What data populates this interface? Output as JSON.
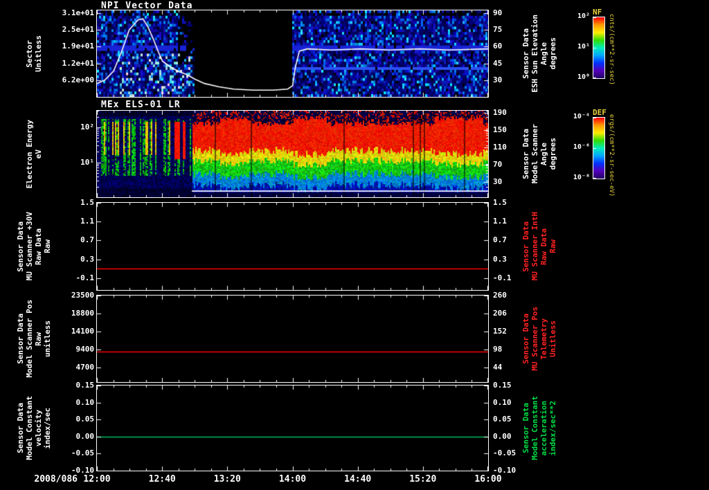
{
  "page": {
    "date_label": "2008/086"
  },
  "x_axis": {
    "t_start": 12,
    "t_end": 16,
    "ticks": [
      {
        "t": 12.0,
        "label": "12:00"
      },
      {
        "t": 12.667,
        "label": "12:40"
      },
      {
        "t": 13.333,
        "label": "13:20"
      },
      {
        "t": 14.0,
        "label": "14:00"
      },
      {
        "t": 14.667,
        "label": "14:40"
      },
      {
        "t": 15.333,
        "label": "15:20"
      },
      {
        "t": 16.0,
        "label": "16:00"
      }
    ]
  },
  "colors": {
    "background": "#000000",
    "frame": "#ffffff",
    "text": "#ffffff",
    "red_line": "#ff0000",
    "red_label": "#ff2222",
    "green_line": "#00c060",
    "green_label": "#00dd44",
    "colorbar_label": "#e8d23c",
    "palette": [
      "#ff0000",
      "#ff9900",
      "#ffee00",
      "#33dd00",
      "#00eebb",
      "#00aaff",
      "#0033ff",
      "#5500bb",
      "#220066"
    ]
  },
  "chart_data": [
    {
      "type": "heatmap",
      "id": "npi-vector",
      "title": "NPI Vector Data",
      "left_axis": {
        "label_lines": [
          "Sector",
          "Unitless"
        ],
        "min": 0,
        "max": 32,
        "ticks": [
          {
            "v": 31,
            "label": "3.1e+01"
          },
          {
            "v": 24.8,
            "label": "2.5e+01"
          },
          {
            "v": 18.6,
            "label": "1.9e+01"
          },
          {
            "v": 12.4,
            "label": "1.2e+01"
          },
          {
            "v": 6.2,
            "label": "6.2e+00"
          }
        ]
      },
      "right_axis": {
        "label_lines": [
          "Sensor Data",
          "ESH Sun Elevation",
          "Angle",
          "degrees"
        ],
        "label_color": "#ffffff",
        "min": 15,
        "max": 92.5,
        "ticks": [
          {
            "v": 90,
            "label": "90"
          },
          {
            "v": 75,
            "label": "75"
          },
          {
            "v": 60,
            "label": "60"
          },
          {
            "v": 45,
            "label": "45"
          },
          {
            "v": 30,
            "label": "30"
          }
        ]
      },
      "heatmap": {
        "style": "npi",
        "data_gap_t": [
          12.98,
          13.99
        ],
        "palette_note": "low count rates, blue/purple mosaic"
      },
      "overlay_line": {
        "name": "sun-elevation-angle",
        "color": "#ffffff",
        "axis": "right",
        "points": [
          [
            12.0,
            27
          ],
          [
            12.08,
            30
          ],
          [
            12.17,
            38
          ],
          [
            12.25,
            55
          ],
          [
            12.33,
            75
          ],
          [
            12.42,
            84
          ],
          [
            12.47,
            85
          ],
          [
            12.52,
            78
          ],
          [
            12.58,
            66
          ],
          [
            12.63,
            55
          ],
          [
            12.67,
            47
          ],
          [
            12.75,
            42
          ],
          [
            12.83,
            38
          ],
          [
            12.92,
            35
          ],
          [
            13.0,
            31
          ],
          [
            13.1,
            27
          ],
          [
            13.25,
            24
          ],
          [
            13.4,
            22
          ],
          [
            13.6,
            21
          ],
          [
            13.8,
            21
          ],
          [
            13.95,
            22
          ],
          [
            14.0,
            25
          ],
          [
            14.03,
            42
          ],
          [
            14.07,
            56
          ],
          [
            14.15,
            58
          ],
          [
            14.4,
            57
          ],
          [
            14.7,
            58
          ],
          [
            15.0,
            57
          ],
          [
            15.3,
            58
          ],
          [
            15.6,
            57
          ],
          [
            16.0,
            58
          ]
        ]
      }
    },
    {
      "type": "heatmap",
      "id": "els-spectrogram",
      "title": "MEx ELS-01 LR",
      "left_axis": {
        "label_lines": [
          "Electron Energy",
          "eV"
        ],
        "log": true,
        "min": 1,
        "max": 300,
        "ticks": [
          {
            "v": 100,
            "label": "10²"
          },
          {
            "v": 10,
            "label": "10¹"
          }
        ]
      },
      "right_axis": {
        "label_lines": [
          "Sensor Data",
          "Model Scanner",
          "Angle",
          "degrees"
        ],
        "label_color": "#ffffff",
        "min": -5,
        "max": 195,
        "ticks": [
          {
            "v": 190,
            "label": "190"
          },
          {
            "v": 150,
            "label": "150"
          },
          {
            "v": 110,
            "label": "110"
          },
          {
            "v": 70,
            "label": "70"
          },
          {
            "v": 30,
            "label": "30"
          }
        ]
      },
      "heatmap": {
        "style": "els",
        "band_start_t": 12.97,
        "palette_note": "intense red 20-100 eV flux band after ~13:00, streaked blue/green before"
      },
      "overlay_line": {
        "name": "low-energy-baseline",
        "color": "#ffffff",
        "axis": "left",
        "points": [
          [
            12.97,
            1.5
          ],
          [
            16.0,
            1.5
          ]
        ]
      }
    },
    {
      "type": "line",
      "id": "mu-scanner-30v",
      "left_axis": {
        "label_lines": [
          "Sensor Data",
          "MU Scanner +30V",
          "Raw Data",
          "Raw"
        ],
        "min": -0.35,
        "max": 1.5,
        "ticks": [
          {
            "v": 1.5,
            "label": "1.5"
          },
          {
            "v": 1.1,
            "label": "1.1"
          },
          {
            "v": 0.7,
            "label": "0.7"
          },
          {
            "v": 0.3,
            "label": "0.3"
          },
          {
            "v": -0.1,
            "label": "-0.1"
          }
        ]
      },
      "right_axis": {
        "label_lines": [
          "Sensor Data",
          "MU Scanner IntH",
          "Raw Data",
          "Raw"
        ],
        "label_color": "#ff2222",
        "min": -0.35,
        "max": 1.5,
        "ticks": [
          {
            "v": 1.5,
            "label": "1.5"
          },
          {
            "v": 1.1,
            "label": "1.1"
          },
          {
            "v": 0.7,
            "label": "0.7"
          },
          {
            "v": 0.3,
            "label": "0.3"
          },
          {
            "v": -0.1,
            "label": "-0.1"
          }
        ]
      },
      "series": [
        {
          "name": "mu-scanner-30v-raw",
          "color": "#ff0000",
          "value": 0.1
        }
      ]
    },
    {
      "type": "line",
      "id": "model-scanner-pos",
      "left_axis": {
        "label_lines": [
          "Sensor Data",
          "Model Scanner Pos",
          "Raw",
          "unitless"
        ],
        "min": 1000,
        "max": 23500,
        "ticks": [
          {
            "v": 23500,
            "label": "23500"
          },
          {
            "v": 18800,
            "label": "18800"
          },
          {
            "v": 14100,
            "label": "14100"
          },
          {
            "v": 9400,
            "label": "9400"
          },
          {
            "v": 4700,
            "label": "4700"
          }
        ]
      },
      "right_axis": {
        "label_lines": [
          "Sensor Data",
          "MU Scanner Pos",
          "Telemetry",
          "Unitless"
        ],
        "label_color": "#ff2222",
        "min": 1.5,
        "max": 260,
        "ticks": [
          {
            "v": 260,
            "label": "260"
          },
          {
            "v": 206,
            "label": "206"
          },
          {
            "v": 152,
            "label": "152"
          },
          {
            "v": 98,
            "label": "98"
          },
          {
            "v": 44,
            "label": "44"
          }
        ]
      },
      "series": [
        {
          "name": "model-scanner-pos-raw",
          "color": "#ff0000",
          "value": 8900
        }
      ]
    },
    {
      "type": "line",
      "id": "model-constant-velocity",
      "left_axis": {
        "label_lines": [
          "Sensor Data",
          "Model Constant",
          "velocity",
          "index/sec"
        ],
        "min": -0.1,
        "max": 0.15,
        "ticks": [
          {
            "v": 0.15,
            "label": "0.15"
          },
          {
            "v": 0.1,
            "label": "0.10"
          },
          {
            "v": 0.05,
            "label": "0.05"
          },
          {
            "v": 0.0,
            "label": "0.00"
          },
          {
            "v": -0.05,
            "label": "-0.05"
          },
          {
            "v": -0.1,
            "label": "-0.10"
          }
        ]
      },
      "right_axis": {
        "label_lines": [
          "Sensor Data",
          "Model Constant",
          "acceleration",
          "index/sec**2"
        ],
        "label_color": "#00dd44",
        "min": -0.1,
        "max": 0.15,
        "ticks": [
          {
            "v": 0.15,
            "label": "0.15"
          },
          {
            "v": 0.1,
            "label": "0.10"
          },
          {
            "v": 0.05,
            "label": "0.05"
          },
          {
            "v": 0.0,
            "label": "0.00"
          },
          {
            "v": -0.05,
            "label": "-0.05"
          },
          {
            "v": -0.1,
            "label": "-0.10"
          }
        ]
      },
      "series": [
        {
          "name": "model-constant-velocity",
          "color": "#00c060",
          "value": 0.0
        }
      ]
    }
  ],
  "colorbars": [
    {
      "name": "NF",
      "unit": "cnts/(cm**2-sr-sec)",
      "tick_labels": [
        "10²",
        "10¹",
        "10⁰"
      ],
      "panel": 0
    },
    {
      "name": "DEF",
      "unit": "ergs/(cm**2-sr-sec-eV)",
      "tick_labels": [
        "10⁻⁴",
        "10⁻⁶",
        "10⁻⁸"
      ],
      "panel": 1
    }
  ]
}
